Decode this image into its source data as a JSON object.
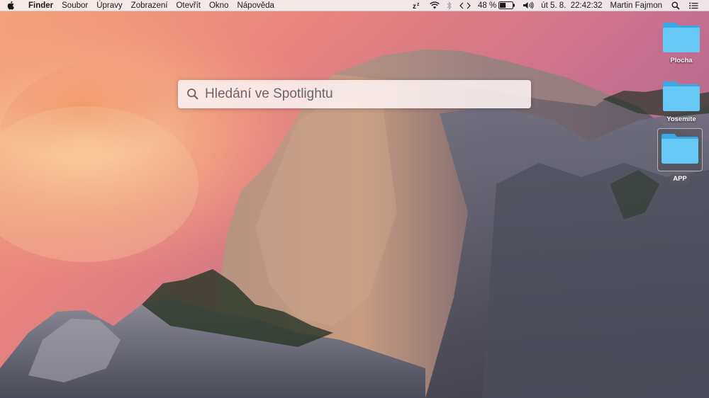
{
  "menubar": {
    "apple_icon": "apple-logo",
    "app_name": "Finder",
    "menus": [
      "Soubor",
      "Úpravy",
      "Zobrazení",
      "Otevřít",
      "Okno",
      "Nápověda"
    ],
    "status": {
      "sleep_icon": "zz-sleep-icon",
      "wifi_icon": "wifi-icon",
      "bluetooth_icon": "bluetooth-icon",
      "code_icon": "code-brackets-icon",
      "battery_percent": "48 %",
      "battery_level": 0.48,
      "volume_icon": "volume-icon",
      "datetime": "út 5. 8.  22:42:32",
      "user": "Martin Fajmon",
      "search_icon": "search-icon",
      "list_icon": "notification-list-icon"
    }
  },
  "spotlight": {
    "placeholder": "Hledání ve Spotlightu",
    "value": ""
  },
  "desktop": {
    "icons": [
      {
        "label": "Plocha",
        "selected": false
      },
      {
        "label": "Yosemite",
        "selected": false
      },
      {
        "label": "APP",
        "selected": true
      }
    ],
    "folder_color": "#5ec3f2"
  }
}
